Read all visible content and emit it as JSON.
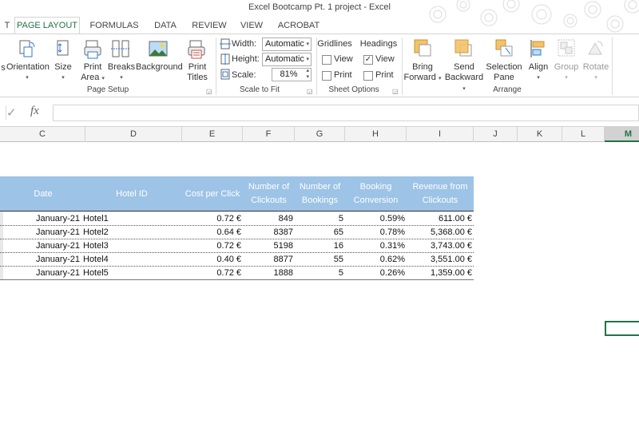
{
  "window": {
    "title": "Excel Bootcamp Pt. 1 project - Excel"
  },
  "tabs": [
    {
      "label": "T",
      "left": 0,
      "width": 20
    },
    {
      "label": "PAGE LAYOUT",
      "active": true
    },
    {
      "label": "FORMULAS"
    },
    {
      "label": "DATA"
    },
    {
      "label": "REVIEW"
    },
    {
      "label": "VIEW"
    },
    {
      "label": "ACROBAT"
    }
  ],
  "ribbon": {
    "page_setup": {
      "orientation": "Orientation",
      "size": "Size",
      "print_area_1": "Print",
      "print_area_2": "Area",
      "breaks": "Breaks",
      "background": "Background",
      "print_titles_1": "Print",
      "print_titles_2": "Titles",
      "group_label": "Page Setup",
      "left_fragment": "s"
    },
    "scale_to_fit": {
      "width_label": "Width:",
      "width_value": "Automatic",
      "height_label": "Height:",
      "height_value": "Automatic",
      "scale_label": "Scale:",
      "scale_value": "81%",
      "group_label": "Scale to Fit"
    },
    "sheet_options": {
      "gridlines": "Gridlines",
      "headings": "Headings",
      "view": "View",
      "print": "Print",
      "group_label": "Sheet Options"
    },
    "arrange": {
      "bring_forward_1": "Bring",
      "bring_forward_2": "Forward",
      "send_backward_1": "Send",
      "send_backward_2": "Backward",
      "selection_pane_1": "Selection",
      "selection_pane_2": "Pane",
      "align": "Align",
      "group": "Group",
      "rotate": "Rotate",
      "group_label": "Arrange"
    }
  },
  "formula_bar": {
    "check": "✓",
    "fx": "fx"
  },
  "columns": [
    "C",
    "D",
    "E",
    "F",
    "G",
    "H",
    "I",
    "J",
    "K",
    "L",
    "M"
  ],
  "table": {
    "headers": {
      "date": "Date",
      "hotel": "Hotel ID",
      "cpc": "Cost per Click",
      "clickouts_1": "Number of",
      "clickouts_2": "Clickouts",
      "bookings_1": "Number of",
      "bookings_2": "Bookings",
      "conversion_1": "Booking",
      "conversion_2": "Conversion",
      "revenue_1": "Revenue from",
      "revenue_2": "Clickouts"
    },
    "rows": [
      {
        "date": "January-21",
        "hotel": "Hotel1",
        "cpc": "0.72 €",
        "clickouts": "849",
        "bookings": "5",
        "conversion": "0.59%",
        "revenue": "611.00 €"
      },
      {
        "date": "January-21",
        "hotel": "Hotel2",
        "cpc": "0.64 €",
        "clickouts": "8387",
        "bookings": "65",
        "conversion": "0.78%",
        "revenue": "5,368.00 €"
      },
      {
        "date": "January-21",
        "hotel": "Hotel3",
        "cpc": "0.72 €",
        "clickouts": "5198",
        "bookings": "16",
        "conversion": "0.31%",
        "revenue": "3,743.00 €"
      },
      {
        "date": "January-21",
        "hotel": "Hotel4",
        "cpc": "0.40 €",
        "clickouts": "8877",
        "bookings": "55",
        "conversion": "0.62%",
        "revenue": "3,551.00 €"
      },
      {
        "date": "January-21",
        "hotel": "Hotel5",
        "cpc": "0.72 €",
        "clickouts": "1888",
        "bookings": "5",
        "conversion": "0.26%",
        "revenue": "1,359.00 €"
      }
    ]
  },
  "colors": {
    "accent": "#217346",
    "table_header": "#9dc3e6"
  }
}
